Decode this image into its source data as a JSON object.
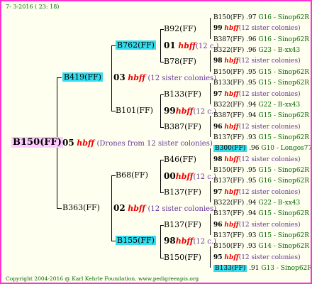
{
  "header": "7- 3-2016 ( 23: 18)",
  "footer": "Copyright 2004-2016 @ Karl Kehrle Foundation.   www.pedigreeapis.org",
  "root": {
    "name": "B150(FF)",
    "gen": "05",
    "breed": "hbff",
    "note": "(Drones from 12 sister colonies)"
  },
  "p1": {
    "name": "B419(FF)",
    "gen": "03",
    "breed": "hbff",
    "note": "(12 sister colonies)"
  },
  "p2": {
    "name": "B363(FF)",
    "gen": "02",
    "breed": "hbff",
    "note": "(12 sister colonies)"
  },
  "g1": {
    "name": "B762(FF)",
    "gen": "01",
    "breed": "hbff",
    "note": "(12 c.)"
  },
  "g2": {
    "name": "B101(FF)"
  },
  "g3": {
    "name": "B68(FF)"
  },
  "g4": {
    "name": "B155(FF)",
    "gen": "98",
    "breed": "hbff",
    "note": "(12 c.)"
  },
  "gg": [
    {
      "name": "B92(FF)"
    },
    {
      "name": "B78(FF)"
    },
    {
      "name": "B133(FF)",
      "gen": "99",
      "breed": "hbff",
      "note": "(12 c.)"
    },
    {
      "name": "B387(FF)"
    },
    {
      "name": "B46(FF)",
      "gen": "00",
      "breed": "hbff",
      "note": "(12 c.)"
    },
    {
      "name": "B137(FF)"
    },
    {
      "name": "B137(FF)"
    },
    {
      "name": "B150(FF)"
    }
  ],
  "leaves": [
    {
      "name": "B150(FF)",
      "yr": ".97",
      "code": "G16 - Sinop62R"
    },
    {
      "gen": "99",
      "breed": "hbff",
      "note": "(12 sister colonies)"
    },
    {
      "name": "B387(FF)",
      "yr": ".96",
      "code": "G16 - Sinop62R"
    },
    {
      "name": "B322(FF)",
      "yr": ".96",
      "code": "G23 - B-xx43"
    },
    {
      "gen": "98",
      "breed": "hbff",
      "note": "(12 sister colonies)"
    },
    {
      "name": "B150(FF)",
      "yr": ".95",
      "code": "G15 - Sinop62R"
    },
    {
      "name": "B133(FF)",
      "yr": ".95",
      "code": "G15 - Sinop62R"
    },
    {
      "gen": "97",
      "breed": "hbff",
      "note": "(12 sister colonies)"
    },
    {
      "name": "B322(FF)",
      "yr": ".94",
      "code": "G22 - B-xx43"
    },
    {
      "name": "B387(FF)",
      "yr": ".94",
      "code": "G15 - Sinop62R"
    },
    {
      "gen": "96",
      "breed": "hbff",
      "note": "(12 sister colonies)"
    },
    {
      "name": "B137(FF)",
      "yr": ".93",
      "code": "G15 - Sinop62R"
    },
    {
      "name": "B300(FF)",
      "yr": ".96",
      "code": "G10 - Longos77R"
    },
    {
      "gen": "98",
      "breed": "hbff",
      "note": "(12 sister colonies)"
    },
    {
      "name": "B150(FF)",
      "yr": ".95",
      "code": "G15 - Sinop62R"
    },
    {
      "name": "B137(FF)",
      "yr": ".95",
      "code": "G16 - Sinop62R"
    },
    {
      "gen": "97",
      "breed": "hbff",
      "note": "(12 sister colonies)"
    },
    {
      "name": "B322(FF)",
      "yr": ".94",
      "code": "G22 - B-xx43"
    },
    {
      "name": "B137(FF)",
      "yr": ".94",
      "code": "G15 - Sinop62R"
    },
    {
      "gen": "96",
      "breed": "hbff",
      "note": "(12 sister colonies)"
    },
    {
      "name": "B137(FF)",
      "yr": ".93",
      "code": "G15 - Sinop62R"
    },
    {
      "name": "B150(FF)",
      "yr": ".93",
      "code": "G14 - Sinop62R"
    },
    {
      "gen": "95",
      "breed": "hbff",
      "note": "(12 sister colonies)"
    },
    {
      "name": "B133(FF)",
      "yr": ".91",
      "code": "G13 - Sinop62R"
    }
  ]
}
